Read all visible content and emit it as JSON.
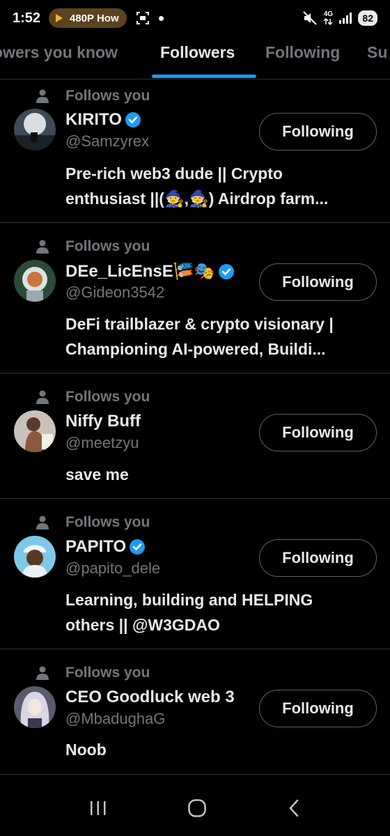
{
  "status_bar": {
    "time": "1:52",
    "media_pill": "480P How",
    "network": "4G",
    "battery": "82"
  },
  "tabs": [
    {
      "label": "owers you know",
      "active": false
    },
    {
      "label": "Followers",
      "active": true
    },
    {
      "label": "Following",
      "active": false
    },
    {
      "label": "Su",
      "active": false
    }
  ],
  "followers": [
    {
      "follows_you": "Follows you",
      "name": "KIRITO",
      "verified": true,
      "handle": "@Samzyrex",
      "bio": [
        "Pre-rich web3 dude || Crypto",
        "enthusiast ||(🧙,🧙) Airdrop farm..."
      ],
      "button": "Following"
    },
    {
      "follows_you": "Follows you",
      "name": "DEe_LicEnsE🎏🎭",
      "verified": true,
      "handle": "@Gideon3542",
      "bio": [
        "DeFi trailblazer & crypto visionary |",
        "Championing AI-powered, Buildi..."
      ],
      "button": "Following"
    },
    {
      "follows_you": "Follows you",
      "name": "Niffy Buff",
      "verified": false,
      "handle": "@meetzyu",
      "bio": [
        "save me"
      ],
      "button": "Following"
    },
    {
      "follows_you": "Follows you",
      "name": "PAPITO",
      "verified": true,
      "handle": "@papito_dele",
      "bio": [
        "Learning, building and HELPING",
        "others || @W3GDAO"
      ],
      "button": "Following"
    },
    {
      "follows_you": "Follows you",
      "name": "CEO Goodluck web 3",
      "verified": false,
      "handle": "@MbadughaG",
      "bio": [
        "Noob"
      ],
      "button": "Following"
    }
  ],
  "colors": {
    "background": "#000000",
    "accent": "#1d9bf0",
    "muted": "#71767b",
    "divider": "#2f3336"
  }
}
